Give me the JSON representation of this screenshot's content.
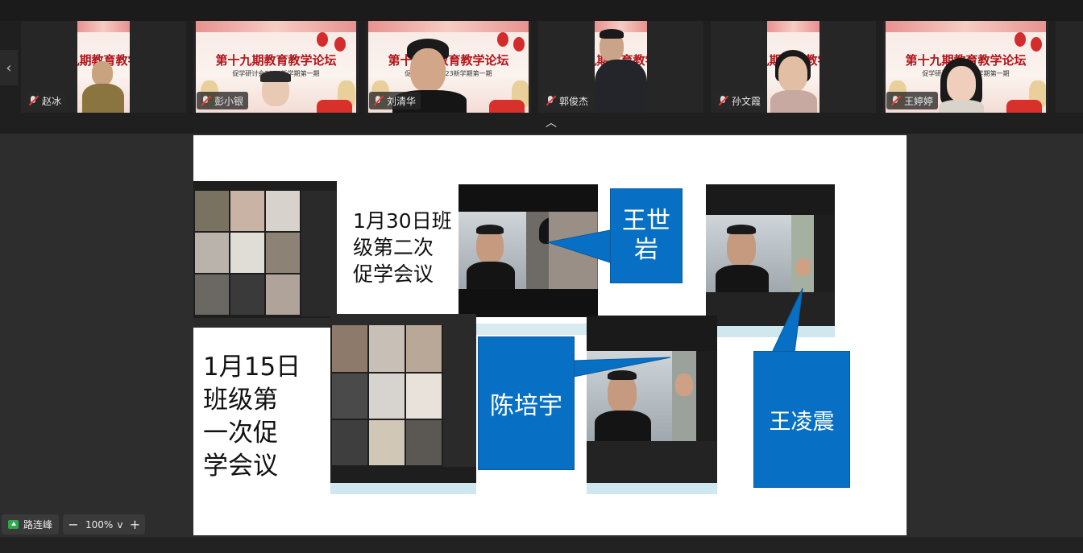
{
  "participants": [
    {
      "name": "赵冰",
      "muted": true
    },
    {
      "name": "彭小银",
      "muted": true
    },
    {
      "name": "刘清华",
      "muted": true
    },
    {
      "name": "郭俊杰",
      "muted": true
    },
    {
      "name": "孙文霞",
      "muted": true
    },
    {
      "name": "王婷婷",
      "muted": true
    }
  ],
  "slide_banner": {
    "title": "第十九期教育教学论坛",
    "subtitle": "促学研讨会2023新学期第一期"
  },
  "shared_slide": {
    "caption_left": "1月15日\n班级第\n一次促\n学会议",
    "caption_top": "1月30日班\n级第二次\n促学会议",
    "callouts": [
      "王世\n岩",
      "陈培宇",
      "王凌震"
    ]
  },
  "bottom": {
    "presenter_name": "路连峰",
    "zoom_level": "100%",
    "zoom_out_symbol": "−",
    "zoom_in_symbol": "+",
    "zoom_dropdown_symbol": "v"
  },
  "controls": {
    "prev_symbol": "‹",
    "collapse_symbol": "︿"
  },
  "colors": {
    "callout_blue": "#0870c4",
    "muted_red": "#e53935",
    "share_green": "#2ea84a",
    "banner_red": "#b3131a"
  }
}
